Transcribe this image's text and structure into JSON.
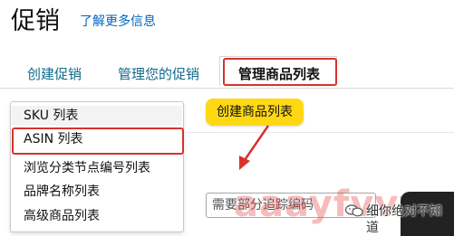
{
  "page": {
    "title": "促销",
    "learn_more": "了解更多信息"
  },
  "tabs": [
    {
      "label": "创建促销"
    },
    {
      "label": "管理您的促销"
    },
    {
      "label": "管理商品列表"
    }
  ],
  "toolbar": {
    "create_list_button": "创建商品列表"
  },
  "dropdown": {
    "items": [
      {
        "label": "SKU 列表"
      },
      {
        "label": "ASIN 列表"
      },
      {
        "label": "浏览分类节点编号列表"
      },
      {
        "label": "品牌名称列表"
      },
      {
        "label": "高级商品列表"
      }
    ]
  },
  "form": {
    "tracking_placeholder": "需要部分追踪编码"
  },
  "overlay": {
    "watermark": "aaayfvvv.com",
    "brand": "细你绝对不知道"
  },
  "colors": {
    "accent_yellow": "#ffd814",
    "highlight_red": "#d8322c",
    "link_blue": "#0066c0"
  }
}
